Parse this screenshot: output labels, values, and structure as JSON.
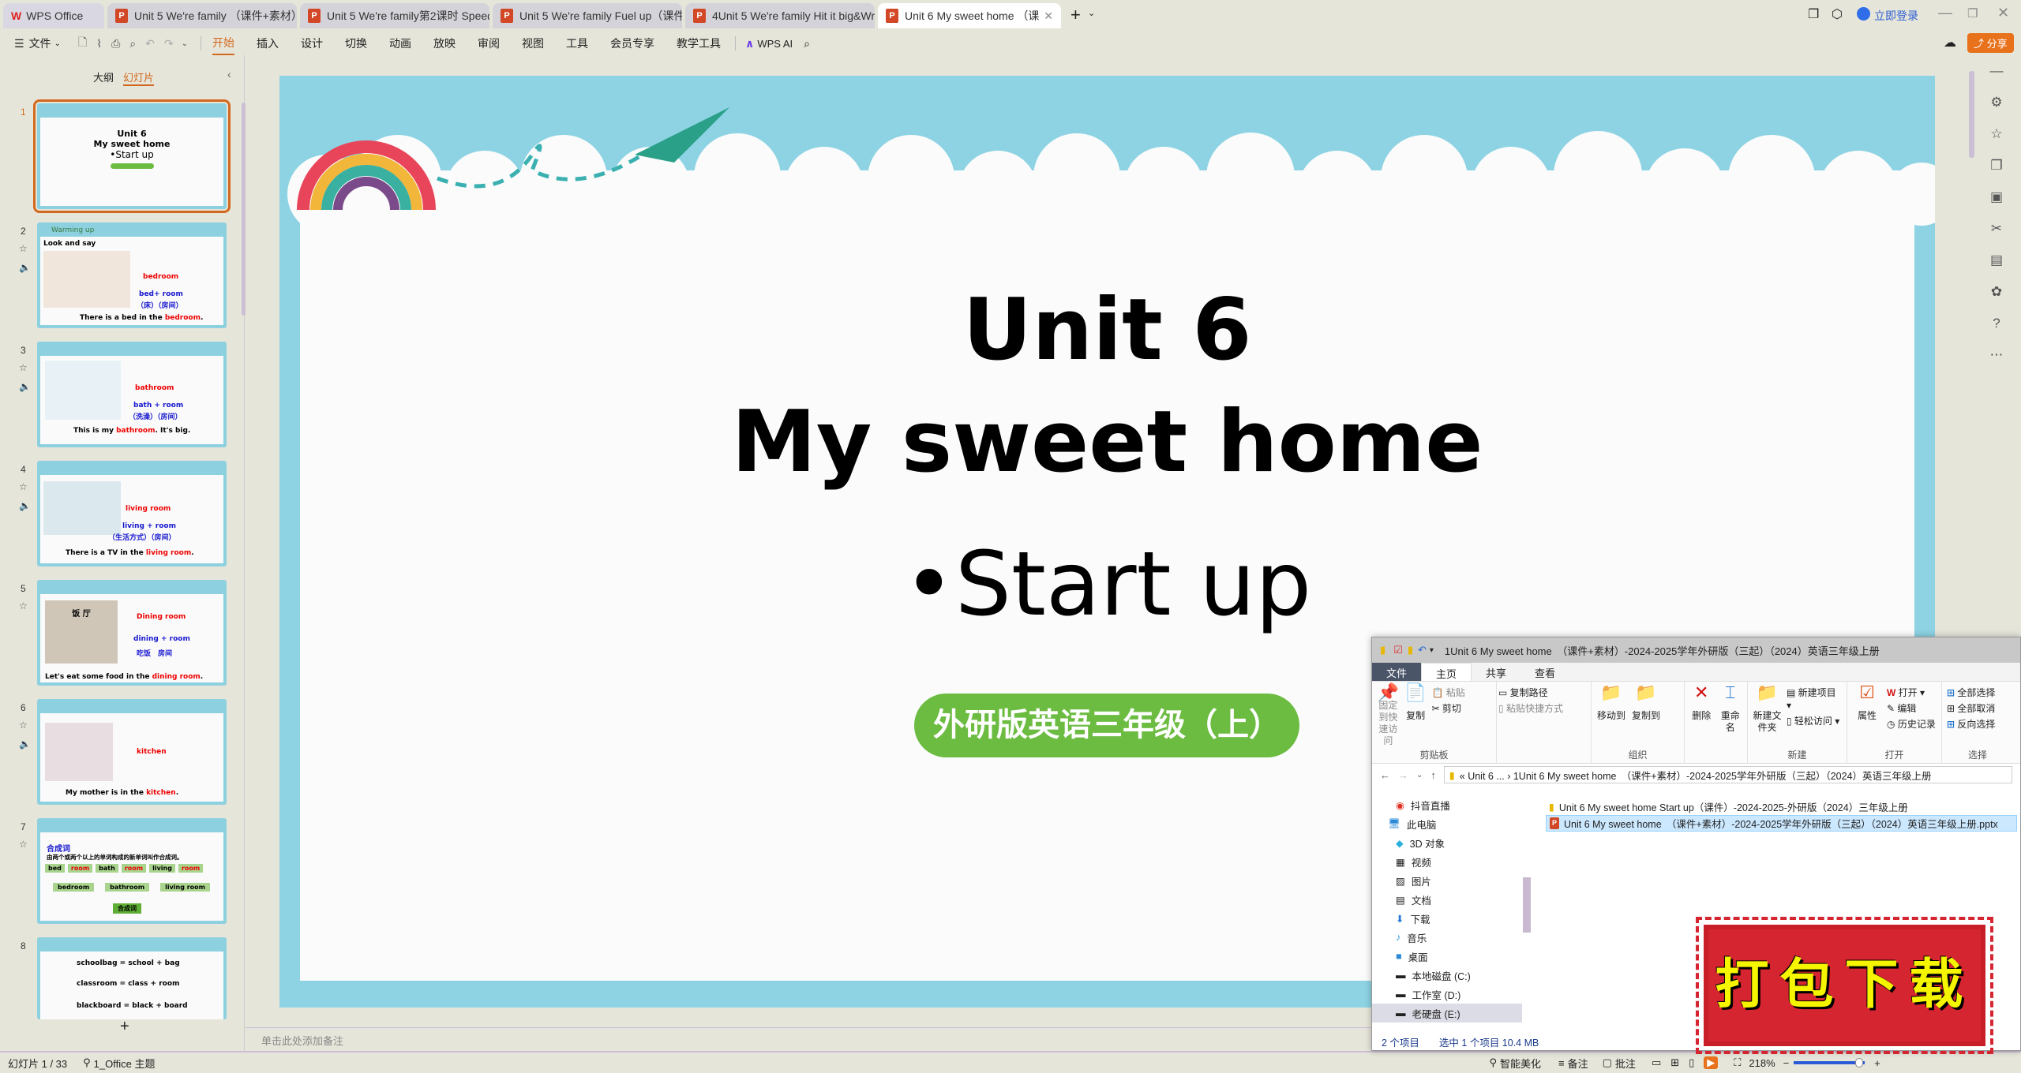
{
  "tabs": [
    {
      "label": "WPS Office",
      "icon": "wps-logo"
    },
    {
      "label": "Unit 5 We're family （课件+素材）"
    },
    {
      "label": "Unit 5 We're family第2课时 Speed"
    },
    {
      "label": "Unit 5 We're family Fuel up（课件+"
    },
    {
      "label": "4Unit 5 We're family Hit it big&Wr"
    },
    {
      "label": "Unit 6 My sweet home （课"
    }
  ],
  "window": {
    "login": "立即登录",
    "share": "分享"
  },
  "toolbar": {
    "file": "文件",
    "menus": [
      "开始",
      "插入",
      "设计",
      "切换",
      "动画",
      "放映",
      "审阅",
      "视图",
      "工具",
      "会员专享",
      "教学工具"
    ],
    "active": "开始",
    "ai": "WPS AI"
  },
  "panel": {
    "tabs": [
      "大纲",
      "幻灯片"
    ],
    "active": "幻灯片",
    "add": "+"
  },
  "thumbnails": [
    {
      "num": "1",
      "lines": [
        "Unit 6",
        "My sweet home",
        "•Start up"
      ]
    },
    {
      "num": "2",
      "header": "Warming up",
      "title": "Look and say",
      "word": "bedroom",
      "parts": "bed+ room",
      "cn": "（床）（房间）",
      "sentence_a": "There is a bed in the ",
      "sentence_b": "bedroom",
      "sentence_c": "."
    },
    {
      "num": "3",
      "word": "bathroom",
      "parts": "bath + room",
      "cn": "（洗澡）（房间）",
      "sentence_a": "This is my ",
      "sentence_b": "bathroom",
      "sentence_c": ". It's big."
    },
    {
      "num": "4",
      "word": "living room",
      "parts": "living + room",
      "cn": "（生活方式）（房间）",
      "sentence_a": "There is a TV in the ",
      "sentence_b": "living room",
      "sentence_c": "."
    },
    {
      "num": "5",
      "word": "Dining room",
      "parts": "dining + room",
      "cn": "吃饭　房间",
      "sign": "饭 厅",
      "sentence_a": "Let's eat some food in the ",
      "sentence_b": "dining room",
      "sentence_c": "."
    },
    {
      "num": "6",
      "word": "kitchen",
      "sentence_a": "My mother is in the ",
      "sentence_b": "kitchen",
      "sentence_c": "."
    },
    {
      "num": "7",
      "title": "合成词",
      "desc": "由两个或两个以上的单词构成的新单词叫作合成词。",
      "words": [
        "bed",
        "room",
        "bath",
        "room",
        "living",
        "room"
      ],
      "compounds": [
        "bedroom",
        "bathroom",
        "living room"
      ],
      "label": "合成词"
    },
    {
      "num": "8",
      "lines": [
        "schoolbag = school + bag",
        "classroom = class + room",
        "blackboard = black + board"
      ]
    }
  ],
  "slide": {
    "line1": "Unit 6",
    "line2": "My sweet home",
    "line3": "•Start up",
    "badge": "外研版英语三年级（上）"
  },
  "notes_placeholder": "单击此处添加备注",
  "status": {
    "slide": "幻灯片 1 / 33",
    "theme": "1_Office 主题",
    "beautify": "智能美化",
    "notes": "备注",
    "comments": "批注",
    "zoom": "218%"
  },
  "explorer": {
    "title": "1Unit 6 My sweet home　（课件+素材）-2024-2025学年外研版（三起）（2024）英语三年级上册",
    "menu": [
      "文件",
      "主页",
      "共享",
      "查看"
    ],
    "groups": {
      "clipboard": "剪贴板",
      "organize": "组织",
      "new": "新建",
      "open": "打开",
      "select": "选择"
    },
    "buttons": {
      "pin": "固定到快速访问",
      "copy": "复制",
      "paste": "粘贴",
      "copy_path": "复制路径",
      "paste_shortcut": "粘贴快捷方式",
      "cut": "剪切",
      "move_to": "移动到",
      "copy_to": "复制到",
      "delete": "删除",
      "rename": "重命名",
      "new_folder": "新建文件夹",
      "new_item": "新建项目",
      "easy_access": "轻松访问",
      "properties": "属性",
      "open": "打开",
      "edit": "编辑",
      "history": "历史记录",
      "select_all": "全部选择",
      "select_none": "全部取消",
      "invert": "反向选择"
    },
    "address": "«  Unit 6 ...  ›  1Unit 6 My sweet home　（课件+素材）-2024-2025学年外研版（三起）（2024）英语三年级上册",
    "nav": [
      "抖音直播",
      "此电脑",
      "3D 对象",
      "视频",
      "图片",
      "文档",
      "下载",
      "音乐",
      "桌面",
      "本地磁盘 (C:)",
      "工作室 (D:)",
      "老硬盘 (E:)"
    ],
    "files": [
      "Unit 6 My sweet home Start up（课件）-2024-2025-外研版（2024）三年级上册",
      "Unit 6 My sweet home　（课件+素材）-2024-2025学年外研版（三起）（2024）英语三年级上册.pptx"
    ],
    "status": "2 个项目　　选中 1 个项目  10.4 MB"
  },
  "stamp": "打包下载",
  "colors": {
    "accent": "#d2691e",
    "slide_sky": "#8dd3e3",
    "badge_green": "#6cbc42",
    "stamp_red": "#d42530"
  }
}
